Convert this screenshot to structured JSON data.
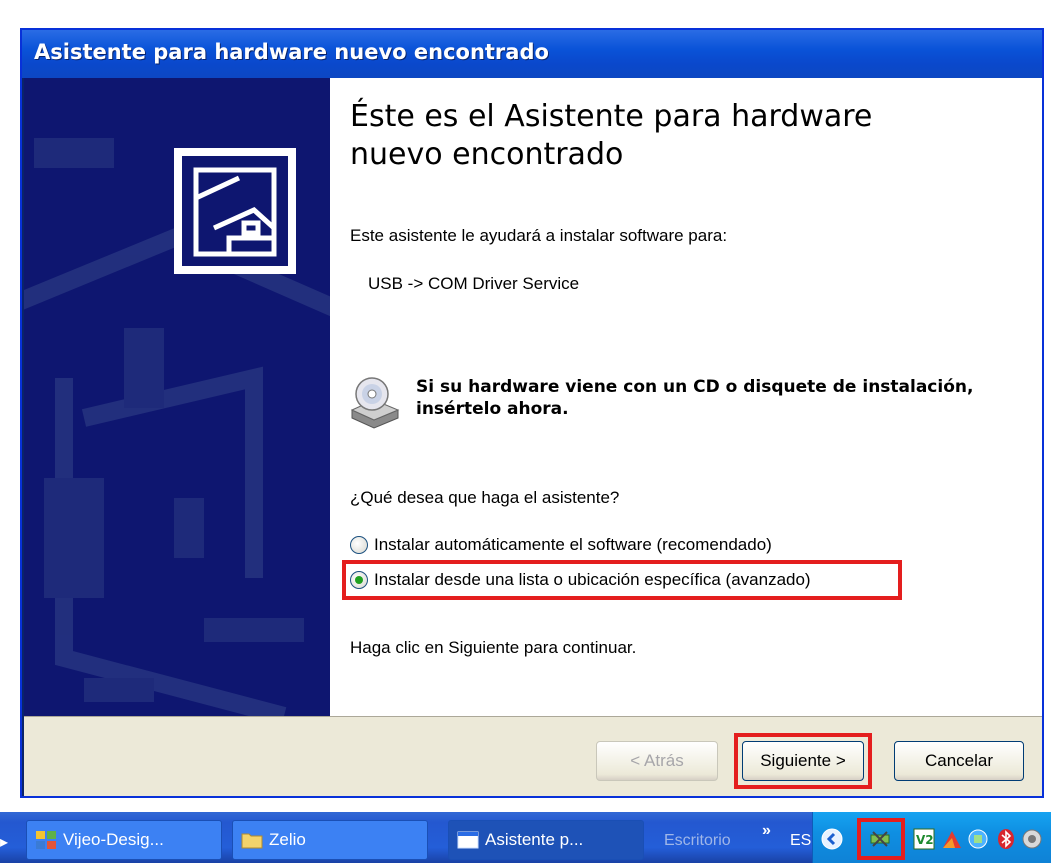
{
  "window": {
    "title": "Asistente para hardware nuevo encontrado"
  },
  "content": {
    "heading": "Éste es el Asistente para hardware nuevo encontrado",
    "intro": "Este asistente le ayudará a instalar software para:",
    "device": "USB -> COM Driver Service",
    "cd_prompt": "Si su hardware viene con un CD o disquete de instalación, insértelo ahora.",
    "question": "¿Qué desea que haga el asistente?",
    "options": [
      {
        "label": "Instalar automáticamente el software (recomendado)",
        "checked": false
      },
      {
        "label": "Instalar desde una lista o ubicación específica (avanzado)",
        "checked": true
      }
    ],
    "continue_text": "Haga clic en Siguiente para continuar."
  },
  "buttons": {
    "back": "< Atrás",
    "next": "Siguiente >",
    "cancel": "Cancelar"
  },
  "taskbar": {
    "tasks": [
      {
        "label": "Vijeo-Desig...",
        "icon": "vijeo-app-icon",
        "active": false
      },
      {
        "label": "Zelio",
        "icon": "folder-icon",
        "active": false
      },
      {
        "label": "Asistente p...",
        "icon": "window-icon",
        "active": true
      }
    ],
    "desktop_label": "Escritorio",
    "overflow": "»",
    "language": "ES"
  },
  "colors": {
    "title_bar": "#0a53d8",
    "banner": "#0e1670",
    "highlight": "#e41e1e",
    "footer": "#ece9d8"
  }
}
